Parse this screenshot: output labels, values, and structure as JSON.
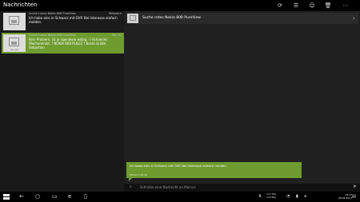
{
  "app": {
    "title": "Nachrichten"
  },
  "toolbar": [
    {
      "name": "refresh-icon",
      "glyph": "⟳"
    },
    {
      "name": "select-list-icon",
      "glyph": "☰"
    },
    {
      "name": "contact-icon",
      "glyph": "☺"
    },
    {
      "name": "delete-icon",
      "glyph": "🗑"
    },
    {
      "name": "more-icon",
      "glyph": "⋯"
    }
  ],
  "conversations": [
    {
      "name": "Suche Lumia Nokia 808 PureView",
      "time": "Mittwoch",
      "message": "Ich habe eins in Schwarz mit OVP. Bei Interesse einfach melden.",
      "thumb_caption": ""
    },
    {
      "name": "Suche Lumia Nokia 808 PureView",
      "time": "Mo 20:",
      "message": "Kein Problem, ist ja irgendwie witzig :-) Schoenes Wochenende, ! NOKIA 808 RULEZ ! Beste Grüße Sebastian",
      "thumb_caption": "Nokia 808"
    }
  ],
  "thread": {
    "title": "Suche rotes Nokia 808 PureView",
    "message": "Ich habe eins in Schwarz mit OVP. Bei Interesse einfach melden.",
    "time": "Mittwoch 09:46"
  },
  "compose": {
    "placeholder": "Schreibe eine Nachricht an Marcus"
  },
  "taskbar": {
    "net_down": "0,27 KB/s",
    "net_up": "0,29 KB/s",
    "time": "19:17",
    "date": "20.03.2017"
  }
}
